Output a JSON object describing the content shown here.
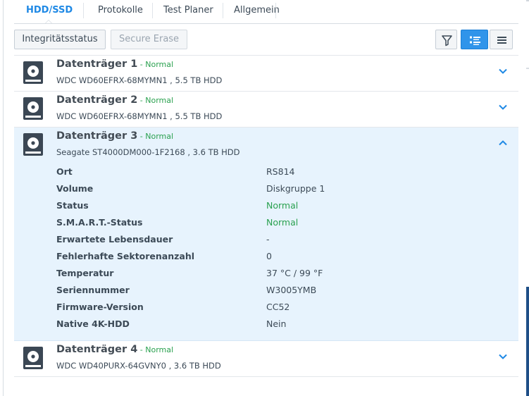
{
  "tabs": [
    {
      "label": "HDD/SSD",
      "active": true
    },
    {
      "label": "Protokolle",
      "active": false
    },
    {
      "label": "Test Planer",
      "active": false
    },
    {
      "label": "Allgemein",
      "active": false
    }
  ],
  "toolbar": {
    "integrity_label": "Integritätsstatus",
    "secure_erase_label": "Secure Erase",
    "filter_icon": "filter-icon",
    "detail_view_icon": "detail-list-icon",
    "list_view_icon": "list-icon"
  },
  "colors": {
    "accent": "#1f89e5",
    "status_ok": "#2aa14f",
    "expanded_bg": "#e7f3fd"
  },
  "disks": [
    {
      "name": "Datenträger 1",
      "separator": " - ",
      "status": "Normal",
      "model": "WDC WD60EFRX-68MYMN1 , 5.5 TB HDD",
      "expanded": false
    },
    {
      "name": "Datenträger 2",
      "separator": " - ",
      "status": "Normal",
      "model": "WDC WD60EFRX-68MYMN1 , 5.5 TB HDD",
      "expanded": false
    },
    {
      "name": "Datenträger 3",
      "separator": " - ",
      "status": "Normal",
      "model": "Seagate ST4000DM000-1F2168 , 3.6 TB HDD",
      "expanded": true,
      "details": [
        {
          "label": "Ort",
          "value": "RS814"
        },
        {
          "label": "Volume",
          "value": "Diskgruppe 1"
        },
        {
          "label": "Status",
          "value": "Normal"
        },
        {
          "label": "S.M.A.R.T.-Status",
          "value": "Normal"
        },
        {
          "label": "Erwartete Lebensdauer",
          "value": "-"
        },
        {
          "label": "Fehlerhafte Sektorenanzahl",
          "value": "0"
        },
        {
          "label": "Temperatur",
          "value": "37 °C / 99 °F"
        },
        {
          "label": "Seriennummer",
          "value": "W3005YMB"
        },
        {
          "label": "Firmware-Version",
          "value": "CC52"
        },
        {
          "label": "Native 4K-HDD",
          "value": "Nein"
        }
      ]
    },
    {
      "name": "Datenträger 4",
      "separator": " - ",
      "status": "Normal",
      "model": "WDC WD40PURX-64GVNY0 , 3.6 TB HDD",
      "expanded": false
    }
  ]
}
